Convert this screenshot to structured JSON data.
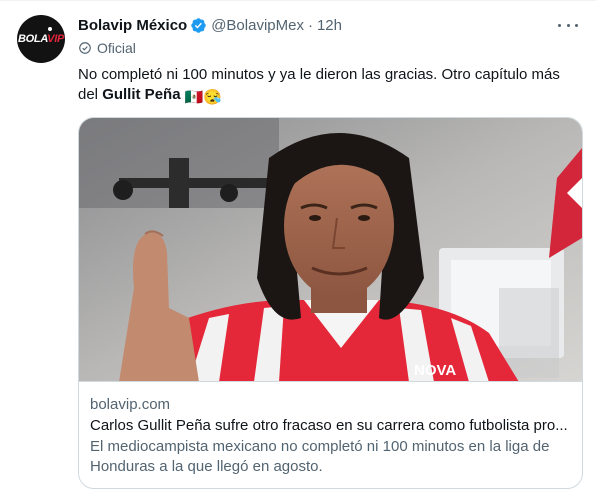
{
  "author": {
    "display_name": "Bolavip México",
    "handle": "@BolavipMex",
    "separator": "·",
    "time": "12h",
    "badge": "Oficial",
    "avatar_logo_main": "BOLA",
    "avatar_logo_accent": "VIP"
  },
  "tweet": {
    "text_part1": "No completó ni 100 minutos y ya le dieron las gracias. Otro capítulo más del ",
    "text_bold": "Gullit Peña",
    "emojis": "🇲🇽😪"
  },
  "card": {
    "domain": "bolavip.com",
    "title": "Carlos Gullit Peña sufre otro fracaso en su carrera como futbolista pro...",
    "description": "El mediocampista mexicano no completó ni 100 minutos en la liga de Honduras a la que llegó en agosto.",
    "jersey_text": "NOVA",
    "image_description": "Player in red and white striped jersey giving a thumbs-up"
  },
  "colors": {
    "text": "#0f1419",
    "secondary": "#536471",
    "verified": "#1d9bf0",
    "border": "#cfd9de",
    "jersey_red": "#e4283a"
  },
  "icons": {
    "verified": "verified-badge-icon",
    "official": "official-check-icon",
    "more": "more-options-icon"
  }
}
